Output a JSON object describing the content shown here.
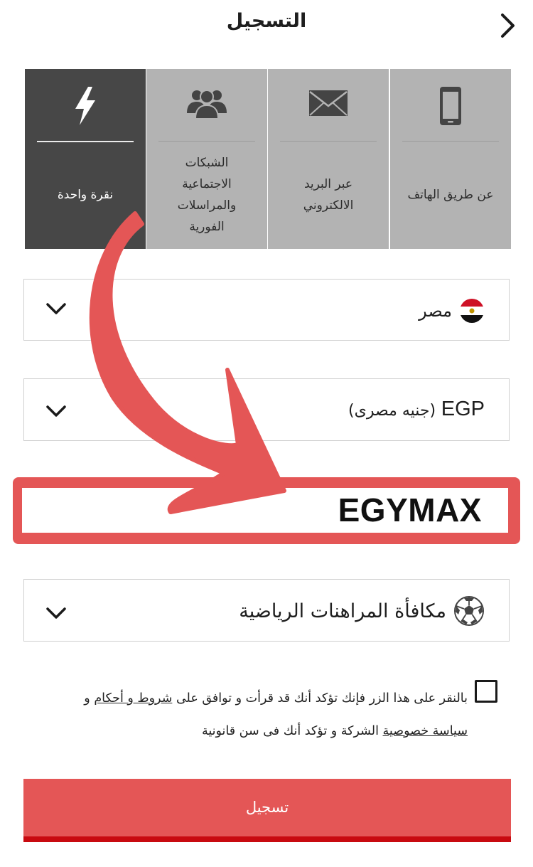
{
  "header": {
    "title": "التسجيل"
  },
  "methods": [
    {
      "label": "نقرة واحدة",
      "icon": "lightning-icon",
      "active": true
    },
    {
      "label": "الشبكات\nالاجتماعية\nوالمراسلات\nالفورية",
      "icon": "users-group-icon",
      "active": false
    },
    {
      "label": "عبر البريد\nالالكتروني",
      "icon": "envelope-icon",
      "active": false
    },
    {
      "label": "عن طريق الهاتف",
      "icon": "phone-icon",
      "active": false
    }
  ],
  "country_select": {
    "value": "مصر",
    "flag_icon": "egypt-flag-icon"
  },
  "currency_select": {
    "code": "EGP",
    "name": "(جنيه مصرى)"
  },
  "promo_code": {
    "value": "EGYMAX"
  },
  "bonus_select": {
    "value": "مكافأة المراهنات الرياضية",
    "icon": "soccer-ball-icon"
  },
  "terms": {
    "line1_prefix": "بالنقر على هذا الزر فإنك تؤكد أنك قد قرأت و توافق على",
    "terms_link": "شروط و أحكام",
    "line1_suffix": "و",
    "privacy_link": "سياسة خصوصية",
    "line2_suffix": "الشركة و تؤكد أنك فى سن قانونية"
  },
  "register_button": {
    "label": "تسجيل"
  },
  "colors": {
    "accent": "#e45656",
    "accent_dark": "#c80a10",
    "tile_active": "#474747",
    "tile": "#b3b3b3"
  }
}
